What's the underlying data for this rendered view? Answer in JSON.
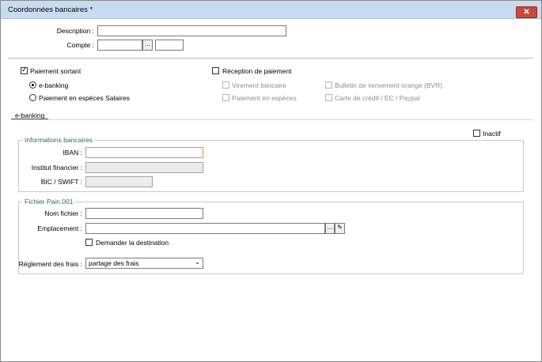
{
  "window": {
    "title": "Coordonnées bancaires *",
    "close_icon": "close-icon"
  },
  "form": {
    "description_label": "Description :",
    "description_value": "",
    "compte_label": "Compte :",
    "compte_value": "",
    "compte_browse": "...",
    "compte_extra_value": ""
  },
  "payment": {
    "sortant_label": "Paiement sortant",
    "sortant_checked": true,
    "ebanking_label": "e-banking",
    "especes_salaires_label": "Paiement en espèces Salaires",
    "reception_label": "Réception de paiement",
    "reception_checked": false,
    "virement_label": "Virement bancaire",
    "especes_label": "Paiement en espèces",
    "bvr_label": "Bulletin de versement orange (BVR)",
    "carte_label": "Carte de crédit / EC / Paypal"
  },
  "tab": {
    "label": "e-banking"
  },
  "inactif_label": "Inactif",
  "bank_info": {
    "group_title": "Informations bancaires",
    "iban_label": "IBAN :",
    "iban_value": "",
    "institut_label": "Institut financier :",
    "institut_value": "",
    "bic_label": "BIC / SWIFT :",
    "bic_value": ""
  },
  "pain": {
    "group_title": "Fichier Pain.001",
    "nom_label": "Nom fichier :",
    "nom_value": "",
    "emplacement_label": "Emplacement :",
    "emplacement_value": "",
    "browse": "...",
    "demander_label": "Demander la destination",
    "reglement_label": "Réglement des frais :",
    "reglement_value": "partage des frais"
  },
  "colors": {
    "accent": "#2e6b52",
    "focus": "#f08a3c",
    "close": "#c84a3b"
  }
}
